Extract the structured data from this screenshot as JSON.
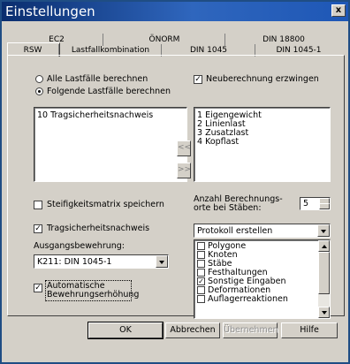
{
  "window": {
    "title": "Einstellungen",
    "close_label": "x"
  },
  "tabs_row1": [
    "EC2",
    "ÖNORM",
    "DIN 18800"
  ],
  "tabs_row2": [
    "RSW",
    "Lastfallkombination",
    "DIN 1045",
    "DIN 1045-1"
  ],
  "active_tab": "RSW",
  "radio_all": {
    "label": "Alle Lastfälle berechnen",
    "selected": false
  },
  "radio_following": {
    "label": "Folgende Lastfälle berechnen",
    "selected": true
  },
  "neuberechnung": {
    "label": "Neuberechnung erzwingen",
    "checked": true
  },
  "left_list": [
    "10 Tragsicherheitsnachweis"
  ],
  "right_list": [
    "1 Eigengewicht",
    "2 Linienlast",
    "3 Zusatzlast",
    "4 Kopflast"
  ],
  "move_left_label": "<<",
  "move_right_label": ">>",
  "steifigkeit": {
    "label": "Steifigkeitsmatrix speichern",
    "checked": false
  },
  "anzahl": {
    "label_line1": "Anzahl Berechnungs-",
    "label_line2": "orte bei Stäben:",
    "value": "5"
  },
  "tragsicherheit": {
    "label": "Tragsicherheitsnachweis",
    "checked": true
  },
  "ausgang": {
    "label": "Ausgangsbewehrung:",
    "value": "K211: DIN 1045-1"
  },
  "auto": {
    "line1": "Automatische",
    "line2": "Bewehrungserhöhung",
    "checked": true
  },
  "protokoll": {
    "value": "Protokoll erstellen",
    "items": [
      {
        "label": "Polygone",
        "checked": false
      },
      {
        "label": "Knoten",
        "checked": false
      },
      {
        "label": "Stäbe",
        "checked": false
      },
      {
        "label": "Festhaltungen",
        "checked": false
      },
      {
        "label": "Sonstige Eingaben",
        "checked": true
      },
      {
        "label": "Deformationen",
        "checked": false
      },
      {
        "label": "Auflagerreaktionen",
        "checked": false
      }
    ]
  },
  "buttons": {
    "ok": "OK",
    "cancel": "Abbrechen",
    "apply": "Übernehmen",
    "help": "Hilfe"
  }
}
